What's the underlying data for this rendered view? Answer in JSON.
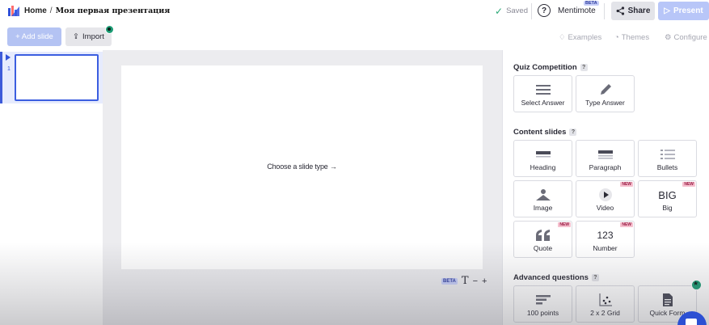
{
  "header": {
    "home_label": "Home",
    "separator": "/",
    "presentation_title": "Моя первая презентация",
    "saved_label": "Saved",
    "mentimote_label": "Mentimote",
    "beta_label": "BETA",
    "share_label": "Share",
    "present_label": "Present"
  },
  "toolbar": {
    "add_slide_label": "Add slide",
    "import_label": "Import",
    "examples_label": "Examples",
    "themes_label": "Themes",
    "configure_label": "Configure"
  },
  "slides": {
    "items": [
      {
        "number": "1"
      }
    ]
  },
  "canvas": {
    "choose_label": "Choose a slide type",
    "beta_label": "BETA",
    "text_icon": "T",
    "zoom_out": "−",
    "zoom_in": "+"
  },
  "panel": {
    "quiz": {
      "title": "Quiz Competition",
      "help": "?",
      "tiles": [
        {
          "label": "Select Answer",
          "icon": "select-answer-icon"
        },
        {
          "label": "Type Answer",
          "icon": "pencil-icon"
        }
      ]
    },
    "content": {
      "title": "Content slides",
      "help": "?",
      "tiles": [
        {
          "label": "Heading",
          "icon": "heading-icon"
        },
        {
          "label": "Paragraph",
          "icon": "paragraph-icon"
        },
        {
          "label": "Bullets",
          "icon": "bullets-icon"
        },
        {
          "label": "Image",
          "icon": "image-icon"
        },
        {
          "label": "Video",
          "icon": "video-icon",
          "badge": "NEW"
        },
        {
          "label": "Big",
          "icon_text": "BIG",
          "badge": "NEW"
        },
        {
          "label": "Quote",
          "icon": "quote-icon",
          "badge": "NEW"
        },
        {
          "label": "Number",
          "icon_text": "123",
          "badge": "NEW"
        }
      ]
    },
    "advanced": {
      "title": "Advanced questions",
      "help": "?",
      "tiles": [
        {
          "label": "100 points",
          "icon": "points-icon"
        },
        {
          "label": "2 x 2 Grid",
          "icon": "grid-icon"
        },
        {
          "label": "Quick Form",
          "icon": "form-icon"
        }
      ]
    }
  },
  "colors": {
    "accent": "#3b5ee0",
    "present_button": "#b8c6f8",
    "new_badge": "#f6c0cf",
    "green_dot": "#1c9c74"
  }
}
